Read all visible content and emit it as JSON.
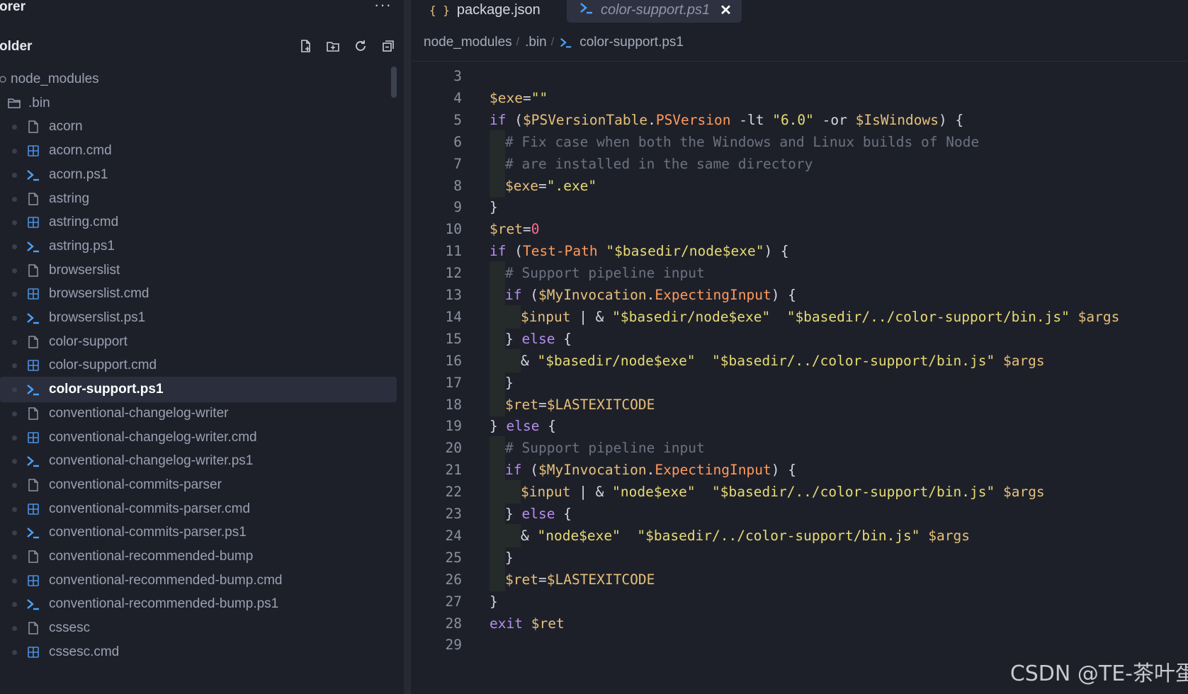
{
  "sidebar": {
    "title": "orer",
    "more": "···",
    "folder": "older",
    "actions": [
      "new-file",
      "new-folder",
      "refresh",
      "collapse-all"
    ],
    "tree": [
      {
        "label": "node_modules",
        "kind": "root"
      },
      {
        "label": ".bin",
        "kind": "folder"
      },
      {
        "label": "acorn",
        "kind": "file"
      },
      {
        "label": "acorn.cmd",
        "kind": "cmd"
      },
      {
        "label": "acorn.ps1",
        "kind": "ps1"
      },
      {
        "label": "astring",
        "kind": "file"
      },
      {
        "label": "astring.cmd",
        "kind": "cmd"
      },
      {
        "label": "astring.ps1",
        "kind": "ps1"
      },
      {
        "label": "browserslist",
        "kind": "file"
      },
      {
        "label": "browserslist.cmd",
        "kind": "cmd"
      },
      {
        "label": "browserslist.ps1",
        "kind": "ps1"
      },
      {
        "label": "color-support",
        "kind": "file"
      },
      {
        "label": "color-support.cmd",
        "kind": "cmd"
      },
      {
        "label": "color-support.ps1",
        "kind": "ps1",
        "selected": true
      },
      {
        "label": "conventional-changelog-writer",
        "kind": "file"
      },
      {
        "label": "conventional-changelog-writer.cmd",
        "kind": "cmd"
      },
      {
        "label": "conventional-changelog-writer.ps1",
        "kind": "ps1"
      },
      {
        "label": "conventional-commits-parser",
        "kind": "file"
      },
      {
        "label": "conventional-commits-parser.cmd",
        "kind": "cmd"
      },
      {
        "label": "conventional-commits-parser.ps1",
        "kind": "ps1"
      },
      {
        "label": "conventional-recommended-bump",
        "kind": "file"
      },
      {
        "label": "conventional-recommended-bump.cmd",
        "kind": "cmd"
      },
      {
        "label": "conventional-recommended-bump.ps1",
        "kind": "ps1"
      },
      {
        "label": "cssesc",
        "kind": "file"
      },
      {
        "label": "cssesc.cmd",
        "kind": "cmd"
      }
    ]
  },
  "tabs": [
    {
      "label": "package.json",
      "icon": "{ }",
      "active": false
    },
    {
      "label": "color-support.ps1",
      "icon": "≥",
      "active": true
    }
  ],
  "breadcrumb": [
    "node_modules",
    ".bin",
    "color-support.ps1"
  ],
  "code": [
    {
      "n": "3",
      "indent": 0,
      "tokens": []
    },
    {
      "n": "4",
      "indent": 0,
      "tokens": [
        [
          "var",
          "$exe"
        ],
        [
          "op",
          "="
        ],
        [
          "str",
          "\"\""
        ]
      ]
    },
    {
      "n": "5",
      "indent": 0,
      "tokens": [
        [
          "kw",
          "if"
        ],
        [
          "op",
          " ("
        ],
        [
          "var",
          "$PSVersionTable"
        ],
        [
          "op",
          "."
        ],
        [
          "prop",
          "PSVersion"
        ],
        [
          "op",
          " -lt "
        ],
        [
          "str",
          "\"6.0\""
        ],
        [
          "op",
          " -or "
        ],
        [
          "var",
          "$IsWindows"
        ],
        [
          "op",
          ") {"
        ]
      ]
    },
    {
      "n": "6",
      "indent": 1,
      "tokens": [
        [
          "cmt",
          "# Fix case when both the Windows and Linux builds of Node"
        ]
      ]
    },
    {
      "n": "7",
      "indent": 1,
      "tokens": [
        [
          "cmt",
          "# are installed in the same directory"
        ]
      ]
    },
    {
      "n": "8",
      "indent": 1,
      "tokens": [
        [
          "var",
          "$exe"
        ],
        [
          "op",
          "="
        ],
        [
          "str",
          "\".exe\""
        ]
      ]
    },
    {
      "n": "9",
      "indent": 0,
      "tokens": [
        [
          "op",
          "}"
        ]
      ]
    },
    {
      "n": "10",
      "indent": 0,
      "tokens": [
        [
          "var",
          "$ret"
        ],
        [
          "op",
          "="
        ],
        [
          "num",
          "0"
        ]
      ]
    },
    {
      "n": "11",
      "indent": 0,
      "tokens": [
        [
          "kw",
          "if"
        ],
        [
          "op",
          " ("
        ],
        [
          "fn",
          "Test-Path"
        ],
        [
          "op",
          " "
        ],
        [
          "str",
          "\"$basedir/node$exe\""
        ],
        [
          "op",
          ") {"
        ]
      ]
    },
    {
      "n": "12",
      "indent": 1,
      "tokens": [
        [
          "cmt",
          "# Support pipeline input"
        ]
      ]
    },
    {
      "n": "13",
      "indent": 1,
      "tokens": [
        [
          "kw",
          "if"
        ],
        [
          "op",
          " ("
        ],
        [
          "var",
          "$MyInvocation"
        ],
        [
          "op",
          "."
        ],
        [
          "prop",
          "ExpectingInput"
        ],
        [
          "op",
          ") {"
        ]
      ]
    },
    {
      "n": "14",
      "indent": 2,
      "tokens": [
        [
          "var",
          "$input"
        ],
        [
          "op",
          " | & "
        ],
        [
          "str",
          "\"$basedir/node$exe\""
        ],
        [
          "op",
          "  "
        ],
        [
          "str",
          "\"$basedir/../color-support/bin.js\""
        ],
        [
          "op",
          " "
        ],
        [
          "var",
          "$args"
        ]
      ]
    },
    {
      "n": "15",
      "indent": 1,
      "tokens": [
        [
          "op",
          "} "
        ],
        [
          "kw",
          "else"
        ],
        [
          "op",
          " {"
        ]
      ]
    },
    {
      "n": "16",
      "indent": 2,
      "tokens": [
        [
          "op",
          "& "
        ],
        [
          "str",
          "\"$basedir/node$exe\""
        ],
        [
          "op",
          "  "
        ],
        [
          "str",
          "\"$basedir/../color-support/bin.js\""
        ],
        [
          "op",
          " "
        ],
        [
          "var",
          "$args"
        ]
      ]
    },
    {
      "n": "17",
      "indent": 1,
      "tokens": [
        [
          "op",
          "}"
        ]
      ]
    },
    {
      "n": "18",
      "indent": 1,
      "tokens": [
        [
          "var",
          "$ret"
        ],
        [
          "op",
          "="
        ],
        [
          "var",
          "$LASTEXITCODE"
        ]
      ]
    },
    {
      "n": "19",
      "indent": 0,
      "tokens": [
        [
          "op",
          "} "
        ],
        [
          "kw",
          "else"
        ],
        [
          "op",
          " {"
        ]
      ]
    },
    {
      "n": "20",
      "indent": 1,
      "tokens": [
        [
          "cmt",
          "# Support pipeline input"
        ]
      ]
    },
    {
      "n": "21",
      "indent": 1,
      "tokens": [
        [
          "kw",
          "if"
        ],
        [
          "op",
          " ("
        ],
        [
          "var",
          "$MyInvocation"
        ],
        [
          "op",
          "."
        ],
        [
          "prop",
          "ExpectingInput"
        ],
        [
          "op",
          ") {"
        ]
      ]
    },
    {
      "n": "22",
      "indent": 2,
      "tokens": [
        [
          "var",
          "$input"
        ],
        [
          "op",
          " | & "
        ],
        [
          "str",
          "\"node$exe\""
        ],
        [
          "op",
          "  "
        ],
        [
          "str",
          "\"$basedir/../color-support/bin.js\""
        ],
        [
          "op",
          " "
        ],
        [
          "var",
          "$args"
        ]
      ]
    },
    {
      "n": "23",
      "indent": 1,
      "tokens": [
        [
          "op",
          "} "
        ],
        [
          "kw",
          "else"
        ],
        [
          "op",
          " {"
        ]
      ]
    },
    {
      "n": "24",
      "indent": 2,
      "tokens": [
        [
          "op",
          "& "
        ],
        [
          "str",
          "\"node$exe\""
        ],
        [
          "op",
          "  "
        ],
        [
          "str",
          "\"$basedir/../color-support/bin.js\""
        ],
        [
          "op",
          " "
        ],
        [
          "var",
          "$args"
        ]
      ]
    },
    {
      "n": "25",
      "indent": 1,
      "tokens": [
        [
          "op",
          "}"
        ]
      ]
    },
    {
      "n": "26",
      "indent": 1,
      "tokens": [
        [
          "var",
          "$ret"
        ],
        [
          "op",
          "="
        ],
        [
          "var",
          "$LASTEXITCODE"
        ]
      ]
    },
    {
      "n": "27",
      "indent": 0,
      "tokens": [
        [
          "op",
          "}"
        ]
      ]
    },
    {
      "n": "28",
      "indent": 0,
      "tokens": [
        [
          "kw",
          "exit"
        ],
        [
          "op",
          " "
        ],
        [
          "var",
          "$ret"
        ]
      ]
    },
    {
      "n": "29",
      "indent": 0,
      "tokens": []
    }
  ],
  "watermark": "CSDN @TE-茶叶蛋",
  "colors": {
    "background": "#1e2029",
    "selected_row": "#2b2f3d",
    "keyword": "#b48ef0",
    "string": "#e6db74",
    "variable": "#e5c07b",
    "comment": "#6c7282",
    "property": "#ff9a5c",
    "number": "#ff6b8a",
    "ps_icon": "#4aa3ff",
    "cmd_icon": "#4a90e2"
  }
}
